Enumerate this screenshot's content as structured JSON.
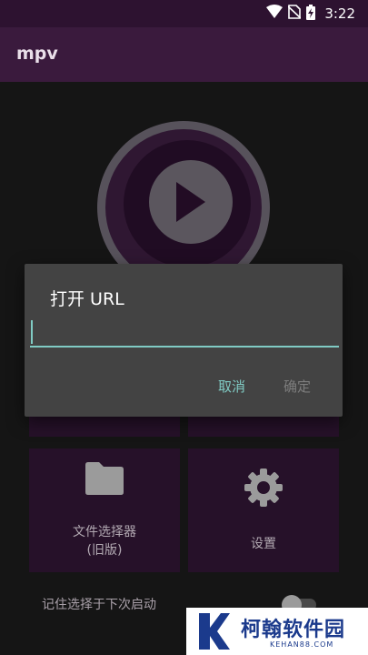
{
  "status_bar": {
    "time": "3:22",
    "icons": [
      "wifi-icon",
      "no-sim-icon",
      "battery-charging-icon"
    ]
  },
  "app_bar": {
    "title": "mpv"
  },
  "tiles": [
    {
      "label": ""
    },
    {
      "label": ""
    },
    {
      "label": "文件选择器\n(旧版)",
      "icon": "folder-icon"
    },
    {
      "label": "设置",
      "icon": "gear-icon"
    }
  ],
  "remember": {
    "label": "记住选择于下次启动",
    "enabled": false
  },
  "dialog": {
    "title": "打开 URL",
    "input_value": "",
    "cancel_label": "取消",
    "ok_label": "确定"
  },
  "watermark": {
    "name": "柯翰软件园",
    "domain": "KEHAN88.COM"
  },
  "colors": {
    "app_bar": "#3a1a3d",
    "tile": "#2f1532",
    "accent": "#80cbc4",
    "dialog": "#434343",
    "background": "#1a1a1a"
  }
}
